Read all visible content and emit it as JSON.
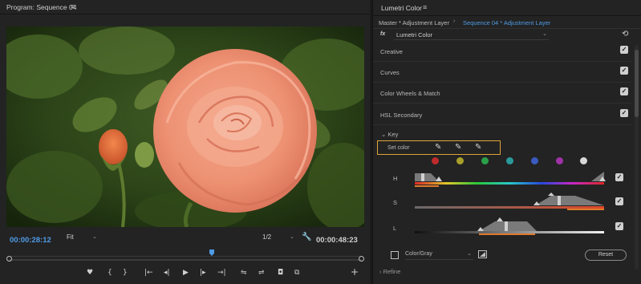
{
  "program": {
    "title": "Program: Sequence 04",
    "menu_icon": "≡",
    "timecode_current": "00:00:28:12",
    "fit": "Fit",
    "resolution": "1/2",
    "timecode_total": "00:00:48:23",
    "transport": {
      "marker": "♥",
      "mark_in": "{",
      "mark_out": "}",
      "go_to_in": "|←",
      "step_back": "◂|",
      "play": "▶",
      "step_forward": "|▸",
      "go_to_out": "→|",
      "insert": "⇋",
      "overwrite": "⇌",
      "export_frame": "◘",
      "compare": "⧉",
      "add": "+"
    }
  },
  "lumetri": {
    "title": "Lumetri Color",
    "menu_icon": "≡",
    "tab_master": "Master * Adjustment Layer",
    "tab_chevron": "›",
    "tab_sequence": "Sequence 04 * Adjustment Layer",
    "fx_label": "fx",
    "effect_name": "Lumetri Color",
    "sections": [
      {
        "label": "Creative",
        "checked": true
      },
      {
        "label": "Curves",
        "checked": true
      },
      {
        "label": "Color Wheels & Match",
        "checked": true
      },
      {
        "label": "HSL Secondary",
        "checked": true
      }
    ],
    "key_label": "Key",
    "set_color_label": "Set color",
    "swatches": [
      "#c02a2a",
      "#a8a02a",
      "#2aa048",
      "#2a9a9a",
      "#3a5ac0",
      "#a032a8",
      "#d8d8d8"
    ],
    "hsl": [
      {
        "label": "H",
        "checked": true
      },
      {
        "label": "S",
        "checked": true
      },
      {
        "label": "L",
        "checked": true
      }
    ],
    "gray_mode": "Color/Gray",
    "reset_label": "Reset",
    "refine_label": "Refine",
    "accent_color": "#4f9be6",
    "highlight_color": "#e0a33a"
  }
}
